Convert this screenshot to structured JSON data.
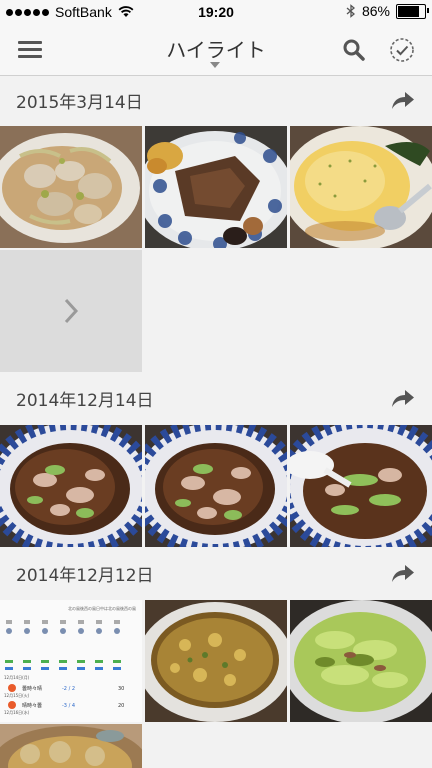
{
  "status_bar": {
    "carrier": "SoftBank",
    "time": "19:20",
    "battery": "86%",
    "battery_level": 0.86
  },
  "header": {
    "title": "ハイライト"
  },
  "sections": [
    {
      "date": "2015年3月14日"
    },
    {
      "date": "2014年12月14日"
    },
    {
      "date": "2014年12月12日"
    }
  ],
  "weather_thumb": {
    "header_text": "北の風後西の風日中は北の風後西の風",
    "rows": [
      "12月14日(月)",
      "12月15日(火)",
      "12月16日(水)"
    ],
    "labels": [
      "曇時々晴",
      "晴時々曇"
    ],
    "temps": [
      "-2 / 2",
      "-3 / 4"
    ],
    "percents": [
      "30",
      "20"
    ]
  },
  "colors": {
    "background": "#f2f2f2",
    "header_bg": "#f7f7f7",
    "icon_gray": "#555555"
  },
  "icons": [
    "menu-icon",
    "search-icon",
    "select-check-icon",
    "share-icon",
    "chevron-right-icon"
  ]
}
